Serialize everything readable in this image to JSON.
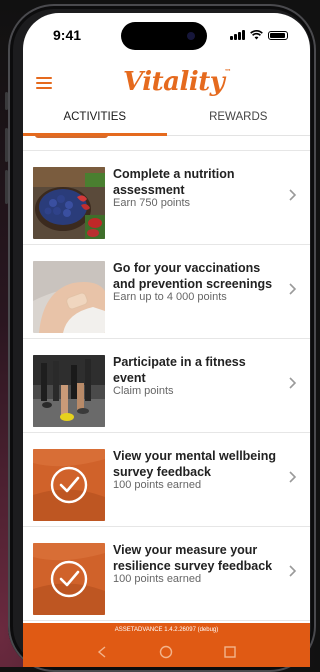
{
  "status_bar": {
    "time": "9:41"
  },
  "app": {
    "logo_text": "Vitality",
    "accent_color": "#e56a1e"
  },
  "tabs": [
    {
      "label": "ACTIVITIES",
      "active": true
    },
    {
      "label": "REWARDS",
      "active": false
    }
  ],
  "activities": [
    {
      "title": "Complete a nutrition assessment",
      "subtitle": "Earn 750 points",
      "image": "nutrition-bowl",
      "completed": false
    },
    {
      "title": "Go for your vaccinations and prevention screenings",
      "subtitle": "Earn up to 4 000 points",
      "image": "vaccination-arm",
      "completed": false
    },
    {
      "title": "Participate in a fitness event",
      "subtitle": "Claim points",
      "image": "runners",
      "completed": false
    },
    {
      "title": "View your mental wellbeing survey feedback",
      "subtitle": "100 points earned",
      "image": "checkmark",
      "completed": true
    },
    {
      "title": "View your measure your resilience survey feedback",
      "subtitle": "100 points earned",
      "image": "checkmark",
      "completed": true
    }
  ],
  "footer": {
    "version_text": "ASSETADVANCE 1.4.2.26097 (debug)"
  },
  "icons": [
    "hamburger-menu-icon",
    "chevron-right-icon",
    "check-circle-icon",
    "back-icon",
    "home-icon",
    "recents-icon"
  ]
}
